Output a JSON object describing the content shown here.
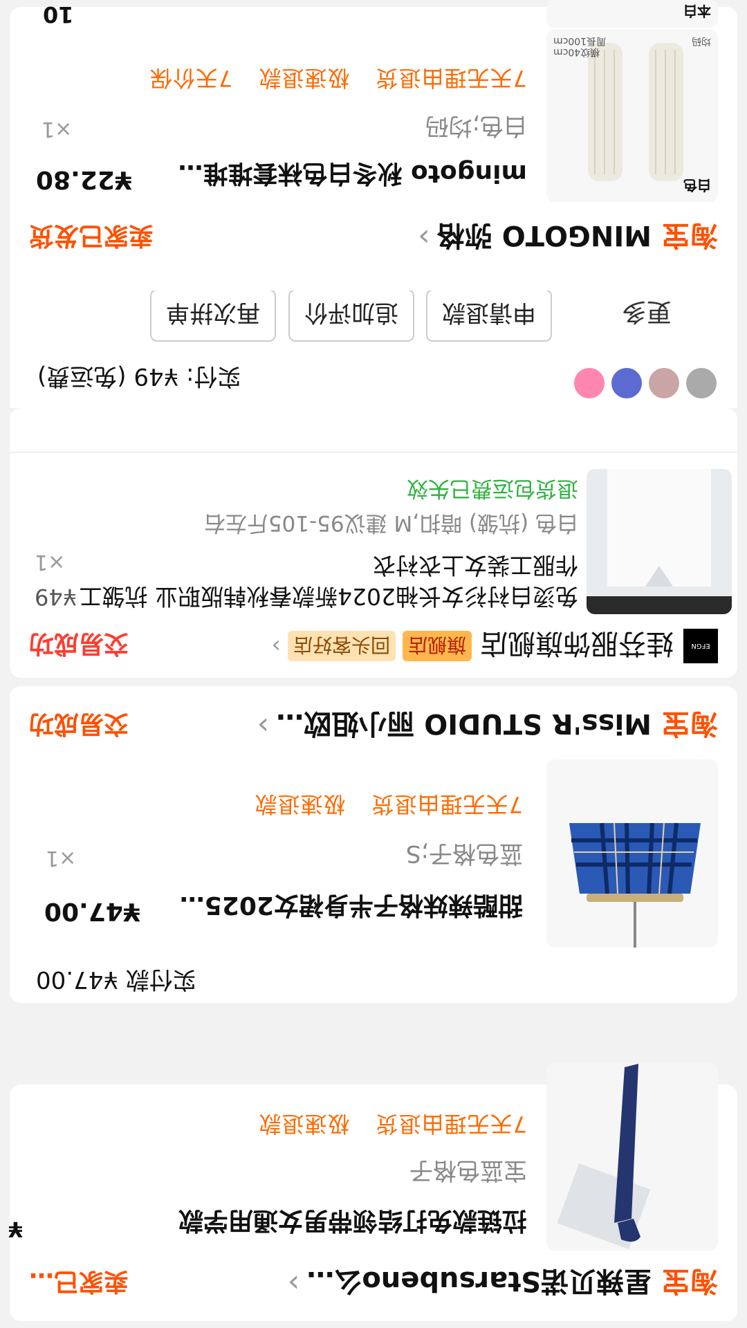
{
  "brand": "淘宝",
  "orders": [
    {
      "shop": "星辣贝诺Starsubeno么…",
      "status": "卖家已…",
      "item": {
        "title": "拉链款免打结领带男女通用学款",
        "price_prefix": "¥",
        "sku": "宝蓝色格子",
        "tags": [
          "7天无理由退货",
          "极速退款"
        ]
      }
    },
    {
      "shop": "Miss'R STUDIO 丽小姐欧…",
      "status": "交易成功",
      "item": {
        "title": "甜酷辣妹格子半身裙女2025春…",
        "price": "¥47.00",
        "sku": "蓝色格子;S",
        "qty": "×1",
        "tags": [
          "7天无理由退货",
          "极速退款"
        ]
      },
      "paid": "实付款 ¥47.00"
    },
    {
      "shop": "娃芬服饰旗舰店",
      "badge_flagship": "旗舰店",
      "badge_repeat": "回头客好店",
      "status": "交易成功",
      "shop_logo_text": "EFGN",
      "item": {
        "title": "免烫白衬衫女长袖2024新款春秋韩版职业 抗皱工作服工装女上衣衬衣",
        "price": "¥49",
        "sku": "白色 (抗皱) 暗扣,M 建议95-105斤左右",
        "qty": "×1",
        "note": "退货包运费已失效"
      },
      "paid": "实付: ¥49 (免运费)",
      "actions": [
        "更多",
        "申请退款",
        "追加评价",
        "再次拼单"
      ]
    },
    {
      "shop": "MINGOTO 弥格",
      "status": "卖家已发货",
      "item": {
        "title": "mingoto 秋冬白色袜套堆堆袜条…",
        "price": "¥22.80",
        "sku": "白色;均码",
        "qty": "×1",
        "tags": [
          "7天无理由退货",
          "极速退款",
          "7天价保"
        ],
        "thumb_labels": [
          "白色",
          "横纹40cm",
          "周長100cm",
          "均码"
        ]
      }
    }
  ],
  "partial_bottom": {
    "item_thumb_label": "本白",
    "qty_partial": "10"
  },
  "colors": {
    "accent": "#ff5000",
    "success_red": "#ff3b30",
    "green_note": "#2fb240"
  }
}
